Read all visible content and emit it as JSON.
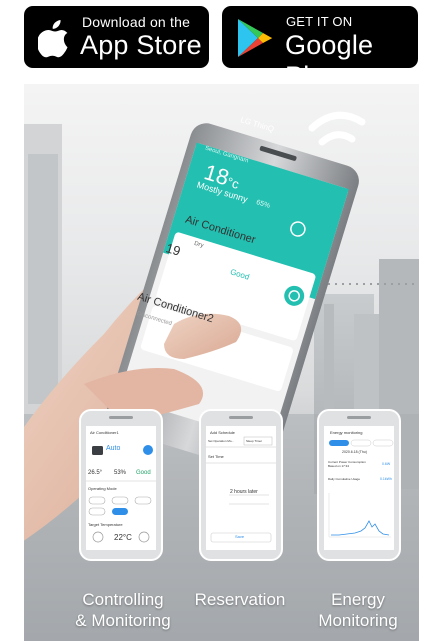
{
  "app_store": {
    "top_text": "Download on the",
    "main_text": "App Store"
  },
  "google_play": {
    "top_text": "GET IT ON",
    "main_text": "Google Play"
  },
  "phone": {
    "brand": "LG ThinQ",
    "location": "Seoul, Gangnam",
    "temperature": "18",
    "temp_unit": "°c",
    "weather": "Mostly sunny",
    "humidity": "65%",
    "device1_name": "Air Conditioner",
    "device1_mode": "Dry",
    "device1_temp": "19",
    "device1_status": "Good",
    "device2_name": "Air Conditioner2",
    "device2_status": "Disconnected"
  },
  "screen1": {
    "header": "Air Conditioner1",
    "mode": "Auto",
    "col1_label": "Indoor Temperature",
    "col2_label": "Indoor Humidity",
    "col3_label": "Overall Air Quality",
    "col1_value": "26.5°",
    "col2_value": "53%",
    "col3_value": "Good",
    "controls": "CONTROLS",
    "operating_mode": "Operating Mode",
    "modes": [
      "Cool",
      "Dry",
      "Fan",
      "Heat",
      "Auto"
    ],
    "target_temp_label": "Target Temperature",
    "target_temp": "22°C"
  },
  "screen2": {
    "header": "Add Schedule",
    "set_operation": "Set Operation Mo...",
    "sleep_timer": "Sleep Timer",
    "set_time": "Set Time",
    "duration": "2  hours later",
    "save": "Save"
  },
  "screen3": {
    "header": "Energy monitoring",
    "tabs": [
      "Day",
      "Week",
      "Month"
    ],
    "date": "2020.6.18 (Thu)",
    "row1_label": "Current Power Consumption Based on 17:34",
    "row1_value": "0.6W",
    "row2_label": "Daily Cumulative Usage",
    "row2_value": "0.1kWh"
  },
  "features": {
    "f1_line1": "Controlling",
    "f1_line2": "& Monitoring",
    "f2_line1": "Reservation",
    "f3_line1": "Energy",
    "f3_line2": "Monitoring"
  },
  "colors": {
    "teal": "#23bfb0",
    "badge_bg": "#000000"
  }
}
